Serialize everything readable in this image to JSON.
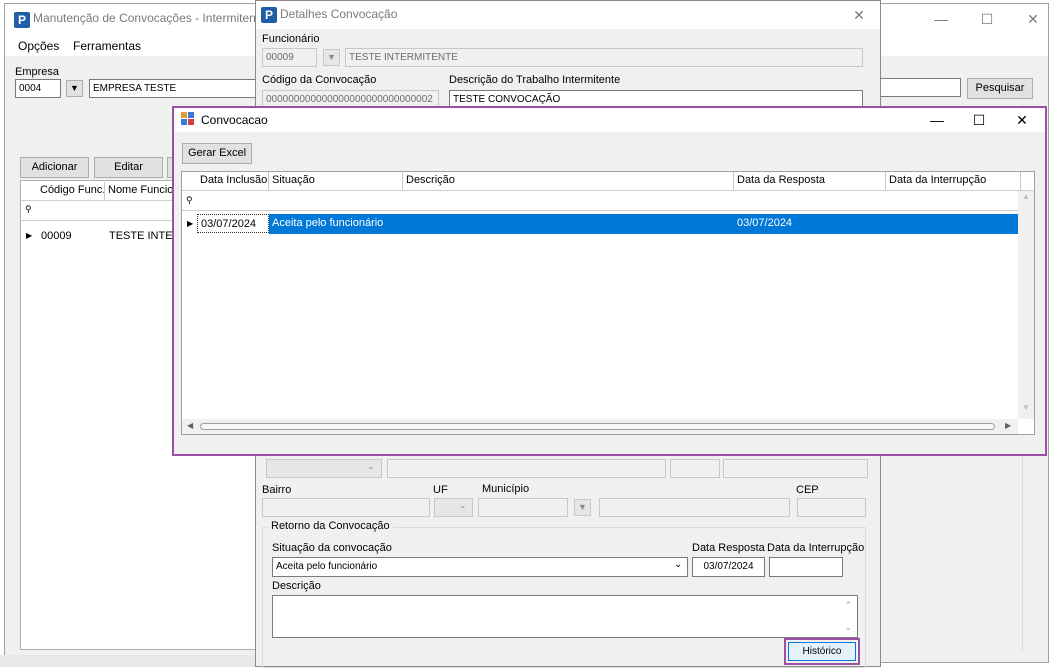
{
  "main_window": {
    "title": "Manutenção de Convocações - Intermitente",
    "menu": [
      "Opções",
      "Ferramentas"
    ],
    "empresa_label": "Empresa",
    "empresa_code": "0004",
    "empresa_name": "EMPRESA TESTE",
    "search_button": "Pesquisar",
    "buttons": [
      "Adicionar",
      "Editar"
    ],
    "grid_headers": [
      "Código Func.",
      "Nome Funciona"
    ],
    "rows": [
      {
        "code": "00009",
        "name": "TESTE INTERM"
      }
    ]
  },
  "details_dialog": {
    "title": "Detalhes Convocação",
    "funcionario_label": "Funcionário",
    "funcionario_code": "00009",
    "funcionario_name": "TESTE INTERMITENTE",
    "codigo_label": "Código da Convocação",
    "codigo_value": "000000000000000000000000000002",
    "descricao_trabalho_label": "Descrição do Trabalho Intermitente",
    "descricao_trabalho_value": "TESTE CONVOCAÇÃO",
    "bairro_label": "Bairro",
    "uf_label": "UF",
    "municipio_label": "Município",
    "cep_label": "CEP",
    "retorno_group": "Retorno da Convocação",
    "situacao_label": "Situação da convocação",
    "situacao_value": "Aceita pelo funcionário",
    "data_resposta_label": "Data Resposta",
    "data_resposta_value": "03/07/2024",
    "data_interrupcao_label": "Data da Interrupção",
    "data_interrupcao_value": "",
    "descricao_label": "Descrição",
    "historico_button": "Histórico"
  },
  "convocacao_window": {
    "title": "Convocacao",
    "gerar_excel": "Gerar Excel",
    "headers": [
      "Data Inclusão",
      "Situação",
      "Descrição",
      "Data da Resposta",
      "Data da Interrupção"
    ],
    "rows": [
      {
        "data_inclusao": "03/07/2024",
        "situacao": "Aceita pelo funcionário",
        "descricao": "",
        "data_resposta": "03/07/2024",
        "data_interrupcao": ""
      }
    ]
  },
  "colors": {
    "highlight": "#9b4fa6",
    "selection": "#0078d7"
  }
}
